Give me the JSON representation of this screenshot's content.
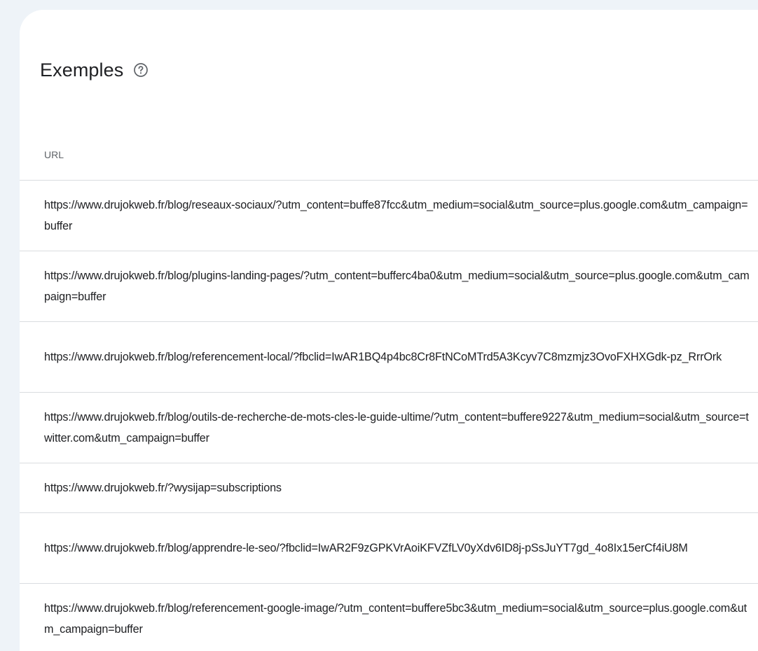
{
  "card": {
    "title": "Exemples",
    "help_icon": "help-circle-icon"
  },
  "table": {
    "column_header": "URL",
    "rows": [
      {
        "url": "https://www.drujokweb.fr/blog/reseaux-sociaux/?utm_content=buffe87fcc&utm_medium=social&utm_source=plus.google.com&utm_campaign=buffer"
      },
      {
        "url": "https://www.drujokweb.fr/blog/plugins-landing-pages/?utm_content=bufferc4ba0&utm_medium=social&utm_source=plus.google.com&utm_campaign=buffer"
      },
      {
        "url": "https://www.drujokweb.fr/blog/referencement-local/?fbclid=IwAR1BQ4p4bc8Cr8FtNCoMTrd5A3Kcyv7C8mzmjz3OvoFXHXGdk-pz_RrrOrk"
      },
      {
        "url": "https://www.drujokweb.fr/blog/outils-de-recherche-de-mots-cles-le-guide-ultime/?utm_content=buffere9227&utm_medium=social&utm_source=twitter.com&utm_campaign=buffer"
      },
      {
        "url": "https://www.drujokweb.fr/?wysijap=subscriptions"
      },
      {
        "url": "https://www.drujokweb.fr/blog/apprendre-le-seo/?fbclid=IwAR2F9zGPKVrAoiKFVZfLV0yXdv6ID8j-pSsJuYT7gd_4o8Ix15erCf4iU8M"
      },
      {
        "url": "https://www.drujokweb.fr/blog/referencement-google-image/?utm_content=buffere5bc3&utm_medium=social&utm_source=plus.google.com&utm_campaign=buffer"
      }
    ]
  },
  "colors": {
    "background": "#eef3f8",
    "card": "#ffffff",
    "divider": "#dadce0",
    "text": "#202124",
    "muted": "#5f6368"
  }
}
